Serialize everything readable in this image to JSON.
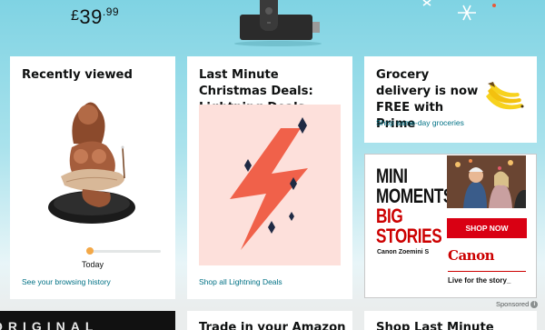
{
  "hero": {
    "price_currency": "£",
    "price_whole": "39",
    "price_fraction": ".99"
  },
  "cards": {
    "recent": {
      "title": "Recently viewed",
      "progress_label": "Today",
      "link": "See your browsing history"
    },
    "deals": {
      "title": "Last Minute Christmas Deals: Lightning Deals",
      "link": "Shop all Lightning Deals",
      "icon": "lightning-bolt-icon"
    },
    "grocery": {
      "title": "Grocery delivery is now FREE with Prime",
      "link": "Shop same-day groceries"
    }
  },
  "ad": {
    "headline": [
      "MINI",
      "MOMENTS,",
      "BIG",
      "STORIES"
    ],
    "product": "Canon Zoemini S",
    "cta": "SHOP NOW",
    "brand": "Canon",
    "tagline": "Live for the story_",
    "sponsored": "Sponsored",
    "colors": {
      "brand_red": "#cc0000",
      "cta_red": "#d90013"
    }
  },
  "bottom_row": {
    "dark_banner_text": "ORIGINAL",
    "card2_title": "Trade in your Amazon",
    "card3_title": "Shop Last Minute"
  },
  "colors": {
    "link": "#007185",
    "background_top": "#7fd3e3",
    "progress": "#f3a847"
  }
}
